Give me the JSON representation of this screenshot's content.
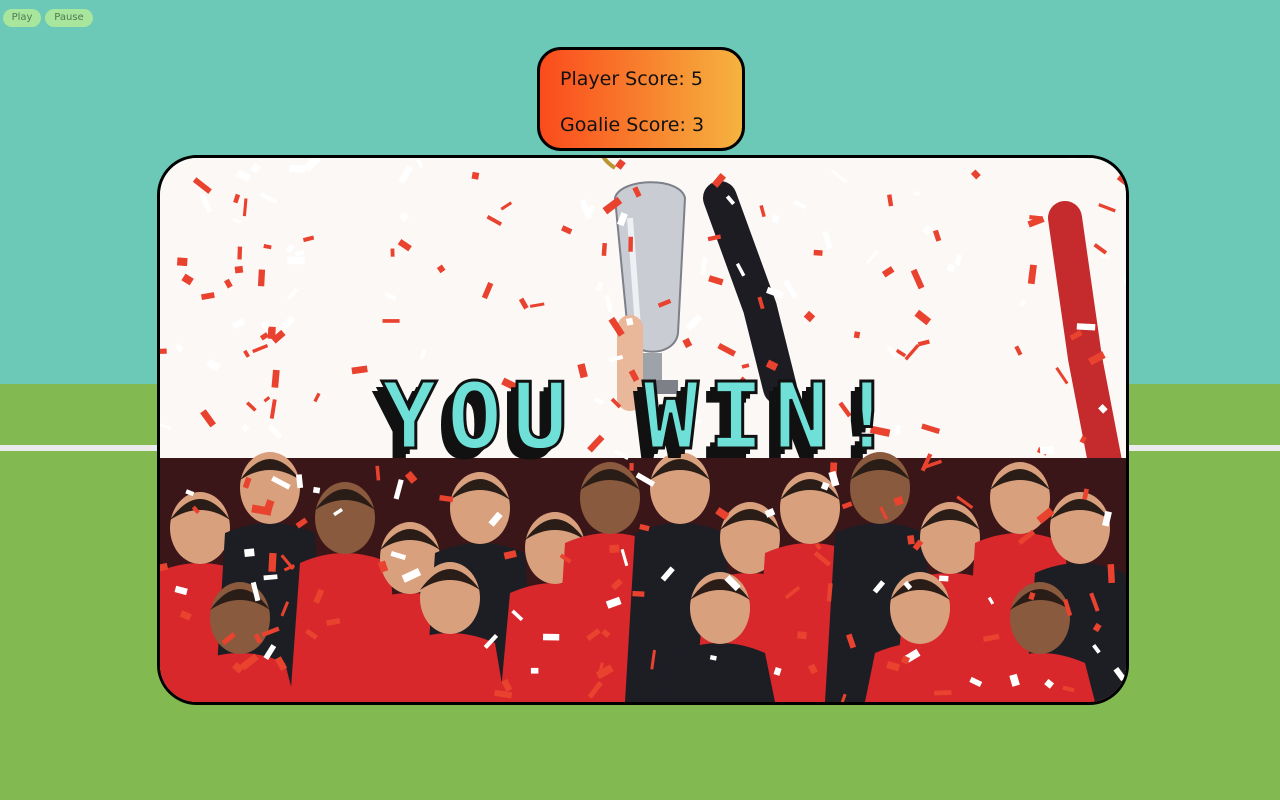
{
  "controls": {
    "play_label": "Play",
    "pause_label": "Pause"
  },
  "scoreboard": {
    "player_label": "Player Score:",
    "player_score": 5,
    "goalie_label": "Goalie Score:",
    "goalie_score": 3
  },
  "result": {
    "message": "YOU WIN!"
  },
  "colors": {
    "sky": "#6cc9b7",
    "grass": "#82b950",
    "button_bg": "#a8e59d",
    "button_text": "#4f7a52",
    "scoreboard_start": "#fb4b1c",
    "scoreboard_end": "#f5b33f",
    "win_text_fill": "#6fe0d8",
    "win_text_shadow": "#111111",
    "jersey_red": "#d8282b",
    "confetti_red": "#e9422f"
  },
  "icons": {
    "celebration_photo": "team-celebration-image",
    "trophy": "trophy-icon"
  }
}
